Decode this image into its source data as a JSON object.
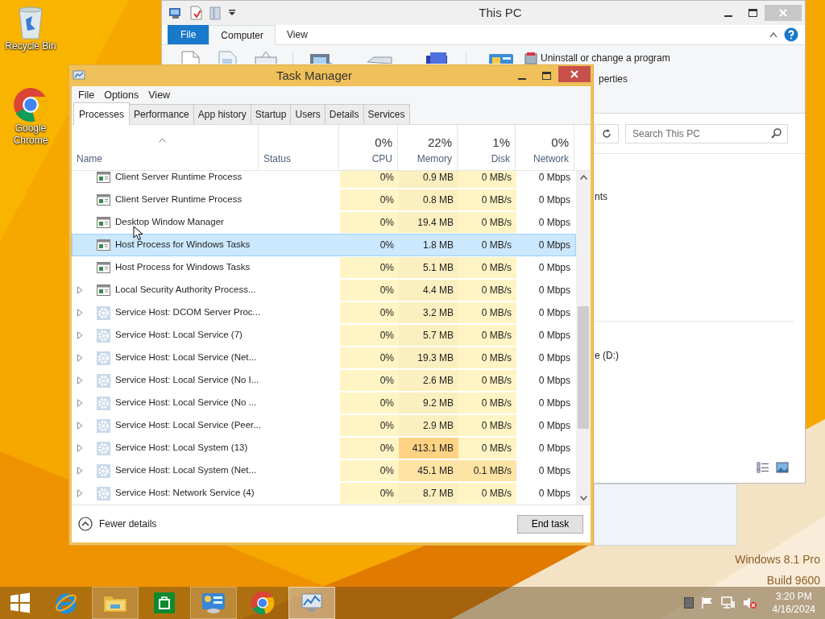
{
  "desktop": {
    "icons": [
      {
        "kind": "recycle",
        "label": "Recycle Bin"
      },
      {
        "kind": "chrome",
        "label": "Google Chrome"
      }
    ],
    "watermark": [
      "Windows 8.1 Pro",
      "Build 9600"
    ]
  },
  "explorer": {
    "title": "This PC",
    "ribbon_tabs": [
      {
        "label": "File",
        "kind": "file",
        "selected": false
      },
      {
        "label": "Computer",
        "kind": "tab",
        "selected": true
      },
      {
        "label": "View",
        "kind": "tab",
        "selected": false
      }
    ],
    "ribbon_commands": [
      "Uninstall or change a program",
      "perties"
    ],
    "search": {
      "placeholder": "Search This PC"
    },
    "content_fragments": [
      "nts",
      "e (D:)"
    ]
  },
  "task_manager": {
    "title": "Task Manager",
    "menu": [
      "File",
      "Options",
      "View"
    ],
    "tabs": [
      {
        "label": "Processes",
        "selected": true
      },
      {
        "label": "Performance",
        "selected": false
      },
      {
        "label": "App history",
        "selected": false
      },
      {
        "label": "Startup",
        "selected": false
      },
      {
        "label": "Users",
        "selected": false
      },
      {
        "label": "Details",
        "selected": false
      },
      {
        "label": "Services",
        "selected": false
      }
    ],
    "columns": [
      {
        "label": "Name"
      },
      {
        "label": "Status"
      },
      {
        "label": "CPU",
        "total": "0%"
      },
      {
        "label": "Memory",
        "total": "22%"
      },
      {
        "label": "Disk",
        "total": "1%"
      },
      {
        "label": "Network",
        "total": "0%"
      }
    ],
    "rows": [
      {
        "kind": "app",
        "expandable": false,
        "selected": false,
        "cells": [
          {
            "text": "Client Server Runtime Process"
          },
          {
            "text": ""
          },
          {
            "text": "0%",
            "color": "#fff4c4"
          },
          {
            "text": "0.9 MB",
            "color": "#fcefbf"
          },
          {
            "text": "0 MB/s",
            "color": "#fff4c4"
          },
          {
            "text": "0 Mbps"
          }
        ]
      },
      {
        "kind": "app",
        "expandable": false,
        "selected": false,
        "cells": [
          {
            "text": "Client Server Runtime Process"
          },
          {
            "text": ""
          },
          {
            "text": "0%",
            "color": "#fff4c4"
          },
          {
            "text": "0.8 MB",
            "color": "#fcefbf"
          },
          {
            "text": "0 MB/s",
            "color": "#fff4c4"
          },
          {
            "text": "0 Mbps"
          }
        ]
      },
      {
        "kind": "app",
        "expandable": false,
        "selected": false,
        "cells": [
          {
            "text": "Desktop Window Manager"
          },
          {
            "text": ""
          },
          {
            "text": "0%",
            "color": "#fff4c4"
          },
          {
            "text": "19.4 MB",
            "color": "#fcefbf"
          },
          {
            "text": "0 MB/s",
            "color": "#fff4c4"
          },
          {
            "text": "0 Mbps"
          }
        ]
      },
      {
        "kind": "app",
        "expandable": false,
        "selected": true,
        "cells": [
          {
            "text": "Host Process for Windows Tasks"
          },
          {
            "text": ""
          },
          {
            "text": "0%"
          },
          {
            "text": "1.8 MB"
          },
          {
            "text": "0 MB/s"
          },
          {
            "text": "0 Mbps"
          }
        ]
      },
      {
        "kind": "app",
        "expandable": false,
        "selected": false,
        "cells": [
          {
            "text": "Host Process for Windows Tasks"
          },
          {
            "text": ""
          },
          {
            "text": "0%",
            "color": "#fff4c4"
          },
          {
            "text": "5.1 MB",
            "color": "#fcefbf"
          },
          {
            "text": "0 MB/s",
            "color": "#fff4c4"
          },
          {
            "text": "0 Mbps"
          }
        ]
      },
      {
        "kind": "app",
        "expandable": true,
        "selected": false,
        "cells": [
          {
            "text": "Local Security Authority Process..."
          },
          {
            "text": ""
          },
          {
            "text": "0%",
            "color": "#fff4c4"
          },
          {
            "text": "4.4 MB",
            "color": "#fcefbf"
          },
          {
            "text": "0 MB/s",
            "color": "#fff4c4"
          },
          {
            "text": "0 Mbps"
          }
        ]
      },
      {
        "kind": "service",
        "expandable": true,
        "selected": false,
        "cells": [
          {
            "text": "Service Host: DCOM Server Proc..."
          },
          {
            "text": ""
          },
          {
            "text": "0%",
            "color": "#fff4c4"
          },
          {
            "text": "3.2 MB",
            "color": "#fcefbf"
          },
          {
            "text": "0 MB/s",
            "color": "#fff4c4"
          },
          {
            "text": "0 Mbps"
          }
        ]
      },
      {
        "kind": "service",
        "expandable": true,
        "selected": false,
        "cells": [
          {
            "text": "Service Host: Local Service (7)"
          },
          {
            "text": ""
          },
          {
            "text": "0%",
            "color": "#fff4c4"
          },
          {
            "text": "5.7 MB",
            "color": "#fcefbf"
          },
          {
            "text": "0 MB/s",
            "color": "#fff4c4"
          },
          {
            "text": "0 Mbps"
          }
        ]
      },
      {
        "kind": "service",
        "expandable": true,
        "selected": false,
        "cells": [
          {
            "text": "Service Host: Local Service (Net..."
          },
          {
            "text": ""
          },
          {
            "text": "0%",
            "color": "#fff4c4"
          },
          {
            "text": "19.3 MB",
            "color": "#fcefbf"
          },
          {
            "text": "0 MB/s",
            "color": "#fff4c4"
          },
          {
            "text": "0 Mbps"
          }
        ]
      },
      {
        "kind": "service",
        "expandable": true,
        "selected": false,
        "cells": [
          {
            "text": "Service Host: Local Service (No I..."
          },
          {
            "text": ""
          },
          {
            "text": "0%",
            "color": "#fff4c4"
          },
          {
            "text": "2.6 MB",
            "color": "#fcefbf"
          },
          {
            "text": "0 MB/s",
            "color": "#fff4c4"
          },
          {
            "text": "0 Mbps"
          }
        ]
      },
      {
        "kind": "service",
        "expandable": true,
        "selected": false,
        "cells": [
          {
            "text": "Service Host: Local Service (No ..."
          },
          {
            "text": ""
          },
          {
            "text": "0%",
            "color": "#fff4c4"
          },
          {
            "text": "9.2 MB",
            "color": "#fcefbf"
          },
          {
            "text": "0 MB/s",
            "color": "#fff4c4"
          },
          {
            "text": "0 Mbps"
          }
        ]
      },
      {
        "kind": "service",
        "expandable": true,
        "selected": false,
        "cells": [
          {
            "text": "Service Host: Local Service (Peer..."
          },
          {
            "text": ""
          },
          {
            "text": "0%",
            "color": "#fff4c4"
          },
          {
            "text": "2.9 MB",
            "color": "#fcefbf"
          },
          {
            "text": "0 MB/s",
            "color": "#fff4c4"
          },
          {
            "text": "0 Mbps"
          }
        ]
      },
      {
        "kind": "service",
        "expandable": true,
        "selected": false,
        "cells": [
          {
            "text": "Service Host: Local System (13)"
          },
          {
            "text": ""
          },
          {
            "text": "0%",
            "color": "#fff4c4"
          },
          {
            "text": "413.1 MB",
            "color": "#ffd383"
          },
          {
            "text": "0 MB/s",
            "color": "#fff4c4"
          },
          {
            "text": "0 Mbps"
          }
        ]
      },
      {
        "kind": "service",
        "expandable": true,
        "selected": false,
        "cells": [
          {
            "text": "Service Host: Local System (Net..."
          },
          {
            "text": ""
          },
          {
            "text": "0%",
            "color": "#fff4c4"
          },
          {
            "text": "45.1 MB",
            "color": "#fde3a4"
          },
          {
            "text": "0.1 MB/s",
            "color": "#fde3a4"
          },
          {
            "text": "0 Mbps"
          }
        ]
      },
      {
        "kind": "service",
        "expandable": true,
        "selected": false,
        "cells": [
          {
            "text": "Service Host: Network Service (4)"
          },
          {
            "text": ""
          },
          {
            "text": "0%",
            "color": "#fff4c4"
          },
          {
            "text": "8.7 MB",
            "color": "#fcefbf"
          },
          {
            "text": "0 MB/s",
            "color": "#fff4c4"
          },
          {
            "text": "0 Mbps"
          }
        ]
      }
    ],
    "footer": {
      "toggle": "Fewer details",
      "button": "End task"
    }
  },
  "taskbar": {
    "buttons": [
      {
        "kind": "start",
        "running": false,
        "active": false
      },
      {
        "kind": "ie",
        "running": false,
        "active": false
      },
      {
        "kind": "explorer",
        "running": true,
        "active": false
      },
      {
        "kind": "store",
        "running": false,
        "active": false
      },
      {
        "kind": "control",
        "running": true,
        "active": false
      },
      {
        "kind": "chrome",
        "running": false,
        "active": false
      },
      {
        "kind": "taskmgr",
        "running": true,
        "active": true
      }
    ],
    "clock": {
      "time": "3:20 PM",
      "date": "4/16/2024"
    }
  }
}
